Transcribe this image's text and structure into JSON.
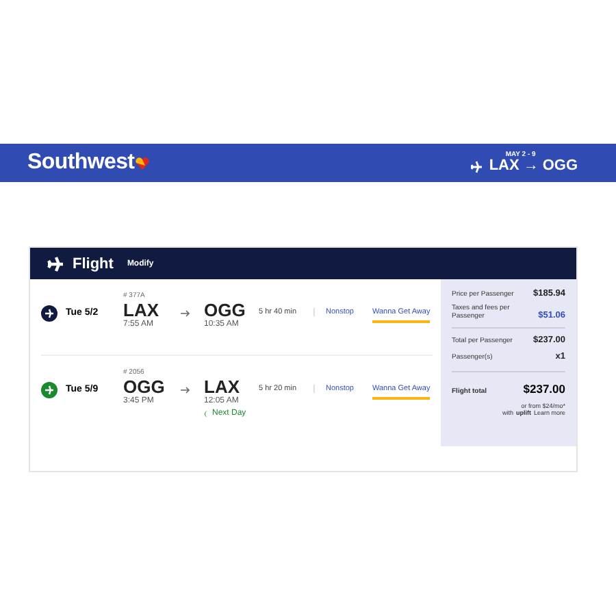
{
  "header": {
    "logo": "Southwest",
    "dates": "MAY 2 - 9",
    "from": "LAX",
    "arrow": "→",
    "to": "OGG"
  },
  "card": {
    "title": "Flight",
    "modify": "Modify"
  },
  "legs": [
    {
      "date": "Tue 5/2",
      "color": "#111b40",
      "number": "# 377A",
      "from": "LAX",
      "depart": "7:55 AM",
      "to": "OGG",
      "arrive": "10:35 AM",
      "duration": "5 hr 40 min",
      "stops": "Nonstop",
      "fare": "Wanna Get Away"
    },
    {
      "date": "Tue 5/9",
      "color": "#1a8a2e",
      "number": "# 2056",
      "from": "OGG",
      "depart": "3:45 PM",
      "to": "LAX",
      "arrive": "12:05 AM",
      "note": "Next Day",
      "duration": "5 hr 20 min",
      "stops": "Nonstop",
      "fare": "Wanna Get Away"
    }
  ],
  "summary": {
    "rows": [
      {
        "label": "Price per Passenger",
        "value": "$185.94",
        "kind": "plain"
      },
      {
        "label": "Taxes and fees per Passenger",
        "value": "$51.06",
        "kind": "link"
      },
      {
        "label": "Total per Passenger",
        "value": "$237.00",
        "kind": "plain"
      },
      {
        "label": "Passenger(s)",
        "value": "x1",
        "kind": "plain"
      }
    ],
    "total_label": "Flight total",
    "total": "$237.00",
    "financing": "or from $24/mo*",
    "with": "with",
    "uplift": "uplift",
    "learn_more": "Learn more"
  }
}
